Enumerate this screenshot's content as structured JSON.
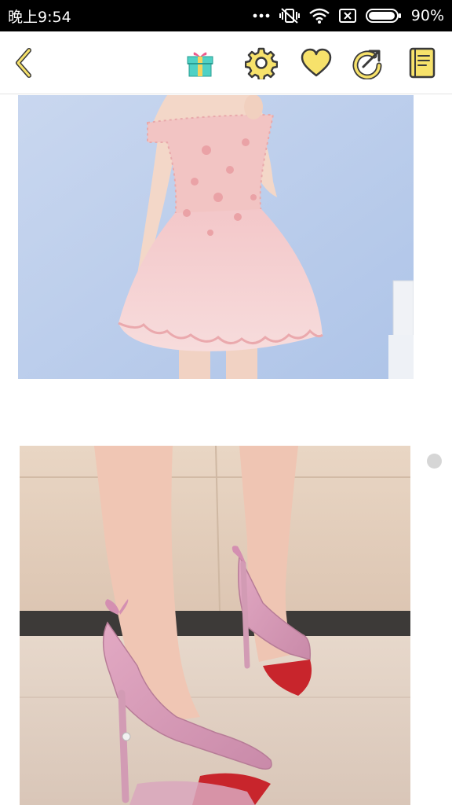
{
  "status_bar": {
    "time": "晚上9:54",
    "battery_percent": "90%",
    "icons": [
      "more-dots-icon",
      "mute-vibrate-icon",
      "wifi-icon",
      "sim-off-icon",
      "battery-icon"
    ]
  },
  "toolbar": {
    "icons": [
      "back-icon",
      "gift-icon",
      "settings-gear-icon",
      "heart-icon",
      "share-icon",
      "notebook-icon"
    ],
    "accent_color": "#f7e26b",
    "stroke_color": "#3a3a3a"
  },
  "content": {
    "images": [
      "pink-lace-dress-photo",
      "pink-heels-photo"
    ]
  }
}
